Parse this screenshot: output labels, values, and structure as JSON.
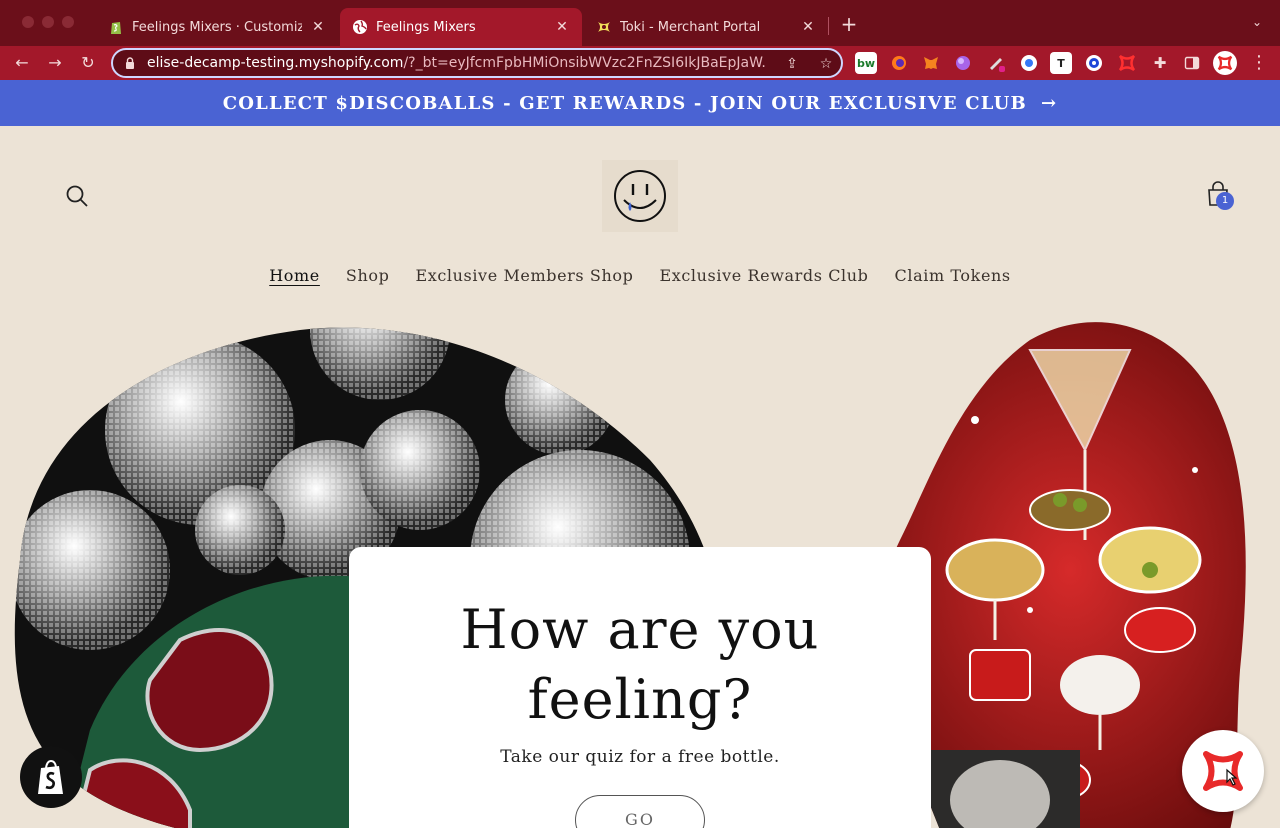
{
  "browser": {
    "tabs": [
      {
        "title": "Feelings Mixers · Customize Re",
        "icon": "shopify-icon",
        "active": false
      },
      {
        "title": "Feelings Mixers",
        "icon": "globe-icon",
        "active": true
      },
      {
        "title": "Toki - Merchant Portal",
        "icon": "toki-icon",
        "active": false
      }
    ],
    "url_host": "elise-decamp-testing.myshopify.com",
    "url_rest": "/?_bt=eyJfcmFpbHMiOnsibWVzc2FnZSI6IkJBaEpJaW...",
    "extensions": [
      "bw-extension-icon",
      "firefox-icon",
      "metamask-icon",
      "purple-extension-icon",
      "pen-extension-icon",
      "chrome-account-icon",
      "notion-icon",
      "target-icon",
      "toki-extension-icon",
      "puzzle-icon",
      "sidepanel-icon"
    ]
  },
  "announcement": {
    "text": "COLLECT $DISCOBALLS - GET REWARDS - JOIN OUR EXCLUSIVE CLUB"
  },
  "header": {
    "cart_count": "1"
  },
  "nav": {
    "items": [
      "Home",
      "Shop",
      "Exclusive Members Shop",
      "Exclusive Rewards Club",
      "Claim Tokens"
    ]
  },
  "hero": {
    "title_line1": "How are you",
    "title_line2": "feeling?",
    "subtitle": "Take our quiz for a free bottle.",
    "button_label": "GO"
  },
  "colors": {
    "tabbar": "#6b0f1a",
    "toolbar": "#a3182a",
    "announcement": "#4a63d3",
    "page_bg": "#ece3d6"
  }
}
